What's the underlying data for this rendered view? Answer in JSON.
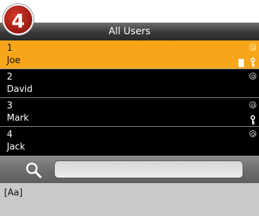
{
  "step_badge": "4",
  "header": {
    "title": "All Users"
  },
  "users": [
    {
      "id": "1",
      "name": "Joe",
      "selected": true,
      "fingerprint": true,
      "card": true,
      "password": true
    },
    {
      "id": "2",
      "name": "David",
      "selected": false,
      "fingerprint": true,
      "card": false,
      "password": false
    },
    {
      "id": "3",
      "name": "Mark",
      "selected": false,
      "fingerprint": true,
      "card": false,
      "password": true
    },
    {
      "id": "4",
      "name": "Jack",
      "selected": false,
      "fingerprint": true,
      "card": false,
      "password": false
    }
  ],
  "search": {
    "value": ""
  },
  "input_mode": "[Aa]",
  "colors": {
    "selected_row": "#f7a61a",
    "list_bg": "#000000",
    "badge": "#c0281c"
  }
}
